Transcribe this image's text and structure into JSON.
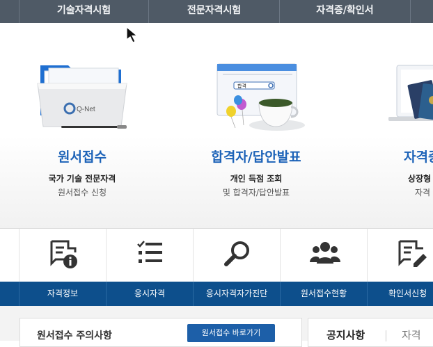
{
  "topnav": {
    "tabs": [
      "기술자격시험",
      "전문자격시험",
      "자격증/확인서"
    ]
  },
  "cards": [
    {
      "title": "원서접수",
      "sub1": "국가 기술 전문자격",
      "sub2": "원서접수 신청",
      "logo": "Q-Net"
    },
    {
      "title": "합격자/답안발표",
      "sub1": "개인 득점 조회",
      "sub2": "및 합격자/답안발표",
      "search_text": "합격"
    },
    {
      "title": "자격증",
      "sub1": "상장형",
      "sub2": "자격"
    }
  ],
  "quicklinks": [
    {
      "label": "자격정보",
      "icon": "document-info-icon"
    },
    {
      "label": "응시자격",
      "icon": "checklist-icon"
    },
    {
      "label": "응시자격자가진단",
      "icon": "magnifier-icon"
    },
    {
      "label": "원서접수현황",
      "icon": "people-group-icon"
    },
    {
      "label": "확인서신청",
      "icon": "document-edit-icon"
    }
  ],
  "bottom": {
    "panel_title": "원서접수 주의사항",
    "panel_button": "원서접수 바로가기",
    "notice_tab": "공지사항",
    "second_tab": "자격"
  },
  "colors": {
    "nav_bg": "#4f5a66",
    "accent": "#1d63b8",
    "label_bar": "#0d4f8c"
  }
}
